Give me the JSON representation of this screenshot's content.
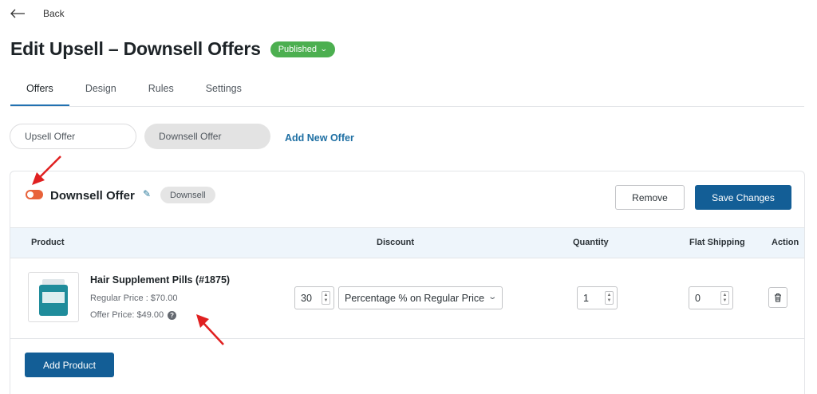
{
  "nav": {
    "back_label": "Back"
  },
  "header": {
    "title": "Edit Upsell – Downsell Offers",
    "status": "Published",
    "status_color": "#4caf50"
  },
  "tabs": [
    {
      "label": "Offers",
      "active": true
    },
    {
      "label": "Design",
      "active": false
    },
    {
      "label": "Rules",
      "active": false
    },
    {
      "label": "Settings",
      "active": false
    }
  ],
  "offer_switcher": {
    "items": [
      {
        "label": "Upsell Offer",
        "selected": false
      },
      {
        "label": "Downsell Offer",
        "selected": true
      }
    ],
    "add_label": "Add New Offer"
  },
  "offer": {
    "name": "Downsell Offer",
    "type_badge": "Downsell",
    "enabled": true,
    "toggle_color": "#e8623a",
    "remove_label": "Remove",
    "save_label": "Save Changes",
    "table": {
      "headers": [
        "Product",
        "Discount",
        "Quantity",
        "Flat Shipping",
        "Action"
      ],
      "rows": [
        {
          "product_name": "Hair Supplement Pills (#1875)",
          "regular_price": "Regular Price : $70.00",
          "offer_price": "Offer Price: $49.00",
          "discount_value": "30",
          "discount_type": "Percentage % on Regular Price",
          "quantity": "1",
          "flat_shipping": "0"
        }
      ]
    },
    "add_product_label": "Add Product"
  },
  "colors": {
    "primary": "#135e96",
    "link": "#1e6fa3",
    "annotation_arrow": "#e02020"
  }
}
